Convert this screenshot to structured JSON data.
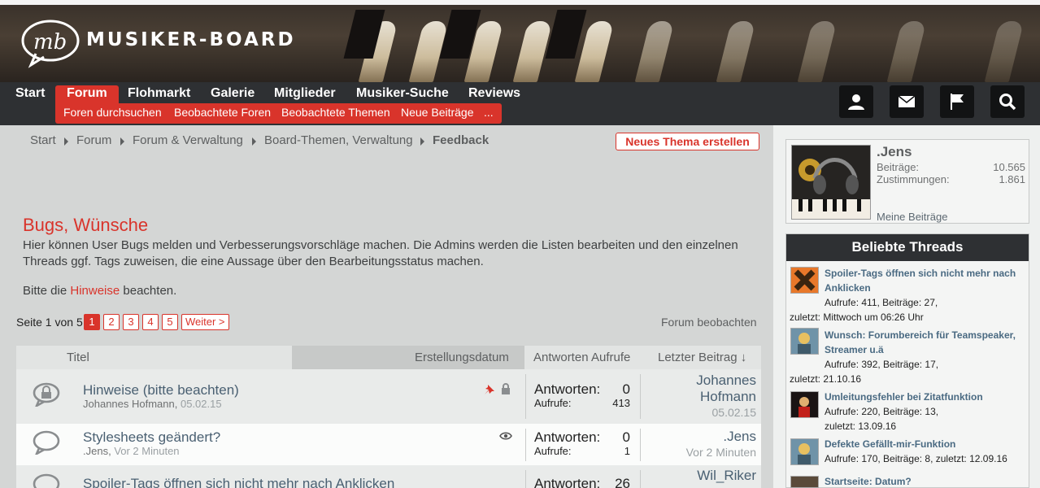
{
  "header": {
    "brand": "MUSIKER-BOARD",
    "nav": [
      "Start",
      "Forum",
      "Flohmarkt",
      "Galerie",
      "Mitglieder",
      "Musiker-Suche",
      "Reviews"
    ],
    "subnav": [
      "Foren durchsuchen",
      "Beobachtete Foren",
      "Beobachtete Themen",
      "Neue Beiträge",
      "..."
    ],
    "icons": [
      "user-icon",
      "mail-icon",
      "flag-icon",
      "search-icon"
    ],
    "accent_color": "#d9342b"
  },
  "breadcrumb": [
    "Start",
    "Forum",
    "Forum & Verwaltung",
    "Board-Themen, Verwaltung",
    "Feedback"
  ],
  "new_thread_label": "Neues Thema erstellen",
  "forum": {
    "title": "Bugs, Wünsche",
    "description": "Hier können User Bugs melden und Verbesserungsvorschläge machen. Die Admins werden die Listen bearbeiten und den einzelnen Threads ggf. Tags zuweisen, die eine Aussage über den Bearbeitungsstatus machen.",
    "note_before": "Bitte die ",
    "note_link": "Hinweise",
    "note_after": " beachten."
  },
  "pagination": {
    "label": "Seite 1 von 5",
    "pages": [
      "1",
      "2",
      "3",
      "4",
      "5"
    ],
    "current": "1",
    "next": "Weiter >"
  },
  "watch_forum": "Forum beobachten",
  "table": {
    "headers": {
      "title": "Titel",
      "created": "Erstellungsdatum",
      "replies": "Antworten",
      "views": "Aufrufe",
      "last": "Letzter Beitrag ↓"
    },
    "rows": [
      {
        "title": "Hinweise (bitte beachten)",
        "author": "Johannes Hofmann",
        "date": "05.02.15",
        "replies_label": "Antworten:",
        "replies": "0",
        "views_label": "Aufrufe:",
        "views": "413",
        "last_user_line1": "Johannes",
        "last_user_line2": "Hofmann",
        "last_date": "05.02.15"
      },
      {
        "title": "Stylesheets geändert?",
        "author": ".Jens",
        "date": "Vor 2 Minuten",
        "replies_label": "Antworten:",
        "replies": "0",
        "views_label": "Aufrufe:",
        "views": "1",
        "last_user": ".Jens",
        "last_date": "Vor 2 Minuten"
      },
      {
        "title": "Spoiler-Tags öffnen sich nicht mehr nach Anklicken",
        "replies_label": "Antworten:",
        "replies": "26",
        "last_user": "Wil_Riker"
      }
    ]
  },
  "sidebar": {
    "user": {
      "name": ".Jens",
      "posts_label": "Beiträge:",
      "posts": "10.565",
      "likes_label": "Zustimmungen:",
      "likes": "1.861",
      "link": "Meine Beiträge"
    },
    "popular_title": "Beliebte Threads",
    "popular": [
      {
        "title_line1": "Spoiler-Tags öffnen sich nicht mehr nach",
        "title_line2": "Anklicken",
        "meta1": "Aufrufe: 411, Beiträge: 27,",
        "meta2": "zuletzt: Mittwoch um 06:26 Uhr"
      },
      {
        "title_line1": "Wunsch: Forumbereich für Teamspeaker,",
        "title_line2": "Streamer u.ä",
        "meta1": "Aufrufe: 392, Beiträge: 17,",
        "meta2": "zuletzt: 21.10.16"
      },
      {
        "title_line1": "Umleitungsfehler bei Zitatfunktion",
        "meta1": "Aufrufe: 220, Beiträge: 13,",
        "meta2": "zuletzt: 13.09.16"
      },
      {
        "title_line1": "Defekte Gefällt-mir-Funktion",
        "meta1": "Aufrufe: 170, Beiträge: 8, zuletzt: 12.09.16"
      },
      {
        "title_line1": "Startseite: Datum?"
      }
    ]
  }
}
